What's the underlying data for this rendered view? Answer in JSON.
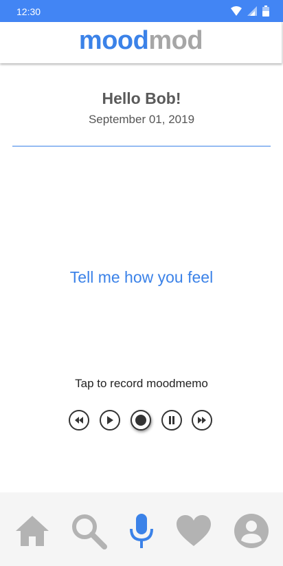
{
  "status_bar": {
    "time": "12:30"
  },
  "app": {
    "logo_part1": "mood",
    "logo_part2": "mod",
    "colors": {
      "status_bar": "#4285f4",
      "accent": "#3b82e8",
      "muted": "#a6a6a6"
    }
  },
  "header": {
    "greeting": "Hello Bob!",
    "date": "September 01, 2019"
  },
  "main": {
    "prompt": "Tell me how you feel",
    "record_hint": "Tap to record moodmemo"
  },
  "controls": {
    "items": [
      {
        "icon": "rewind-icon"
      },
      {
        "icon": "play-icon"
      },
      {
        "icon": "record-icon"
      },
      {
        "icon": "pause-icon"
      },
      {
        "icon": "fast-forward-icon"
      }
    ]
  },
  "bottom_nav": {
    "items": [
      {
        "icon": "home-icon",
        "active": false
      },
      {
        "icon": "search-icon",
        "active": false
      },
      {
        "icon": "microphone-icon",
        "active": true
      },
      {
        "icon": "heart-icon",
        "active": false
      },
      {
        "icon": "account-icon",
        "active": false
      }
    ]
  }
}
